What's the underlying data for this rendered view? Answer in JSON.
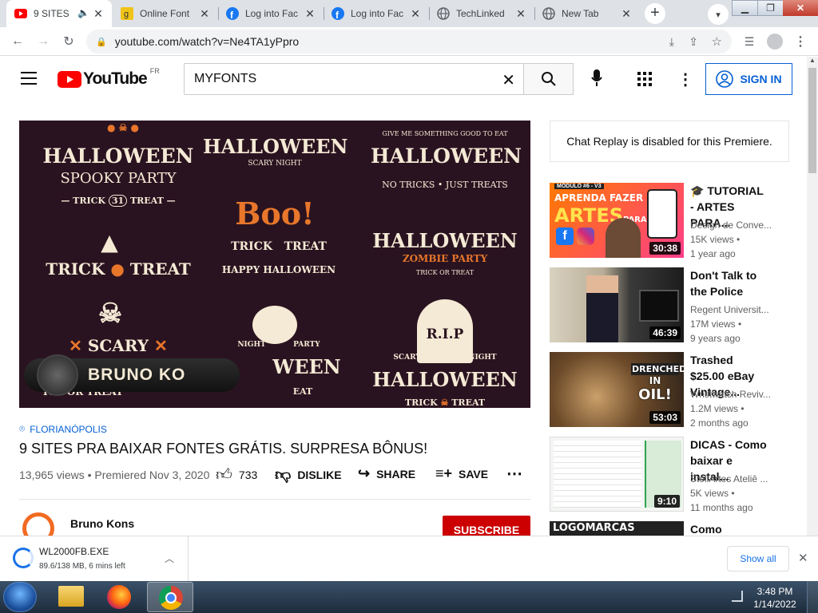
{
  "tabs": [
    {
      "title": "9 SITES",
      "icon": "youtube-icon",
      "audio": true
    },
    {
      "title": "Online Font",
      "icon": "font-site-icon"
    },
    {
      "title": "Log into Fac",
      "icon": "facebook-icon"
    },
    {
      "title": "Log into Fac",
      "icon": "facebook-icon"
    },
    {
      "title": "TechLinked",
      "icon": "globe-icon"
    },
    {
      "title": "New Tab",
      "icon": "chrome-icon"
    }
  ],
  "toolbar": {
    "url": "youtube.com/watch?v=Ne4TA1yPpro"
  },
  "yt": {
    "logo": "YouTube",
    "region": "FR",
    "search_value": "MYFONTS",
    "signin": "SIGN IN"
  },
  "video": {
    "overlay_name": "BRUNO KO",
    "art": {
      "c1_title": "HALLOWEEN",
      "c1_sub": "SPOOKY PARTY",
      "c1_trick": "TRICK",
      "c1_num": "31",
      "c1_treat": "TREAT",
      "c2_title": "HALLOWEEN",
      "c2_sub": "SCARY NIGHT",
      "c3_top": "GIVE ME SOMETHING GOOD TO EAT",
      "c3_title": "HALLOWEEN",
      "c3_sub": "NO TRICKS • JUST TREATS",
      "trick_treat": "TRICK",
      "trick_treat2": "TREAT",
      "boo": "Boo!",
      "mid_trick": "TRICK",
      "mid_treat": "TREAT",
      "happy": "HAPPY HALLOWEEN",
      "zombie_title": "HALLOWEEN",
      "zombie_sub": "ZOMBIE PARTY",
      "zombie_small": "TRICK OR TREAT",
      "scary": "SCARY",
      "night": "NIGHT",
      "party": "PARTY",
      "bottom_mid": "WEEN",
      "rip": "R.I.P",
      "scary2": "SCARY",
      "night2": "NIGHT",
      "bottom_right": "HALLOWEEN",
      "br_trick": "TRICK",
      "br_treat": "TREAT",
      "left_bottom": "ICK OR TREAT",
      "mid_bottom": "EAT"
    }
  },
  "meta": {
    "location": "FLORIANÓPOLIS",
    "title": "9 SITES PRA BAIXAR FONTES GRÁTIS. SURPRESA BÔNUS!",
    "views": "13,965 views",
    "premiered": "Premiered Nov 3, 2020",
    "likes": "733",
    "dislike": "DISLIKE",
    "share": "SHARE",
    "save": "SAVE",
    "channel": "Bruno Kons",
    "subscribe": "SUBSCRIBE"
  },
  "sidebar": {
    "chat_replay": "Chat Replay is disabled for this Premiere.",
    "recs": [
      {
        "title": "🎓 TUTORIAL - ARTES PARA...",
        "channel": "Design de Conve...",
        "views": "15K views •",
        "age": "1 year ago",
        "duration": "30:38",
        "thumb": {
          "tag": "MÓDULO #6 - V3",
          "l1": "APRENDA FAZER",
          "l2": "ARTES",
          "l3": "PARA"
        }
      },
      {
        "title": "Don't Talk to the Police",
        "channel": "Regent Universit...",
        "views": "17M views •",
        "age": "9 years ago",
        "duration": "46:39"
      },
      {
        "title": "Trashed $25.00 eBay Vintage...",
        "channel": "Wristwatch Reviv...",
        "views": "1.2M views •",
        "age": "2 months ago",
        "duration": "53:03",
        "thumb": {
          "l1": "DRENCHED",
          "l2": "IN",
          "l3": "OIL!"
        }
      },
      {
        "title": "DICAS - Como baixar e instal...",
        "channel": "StellArtes Ateliê ...",
        "views": "5K views •",
        "age": "11 months ago",
        "duration": "9:10"
      },
      {
        "title": "Como",
        "thumb": {
          "l1": "LOGOMARCAS"
        }
      }
    ]
  },
  "download": {
    "filename": "WL2000FB.EXE",
    "status": "89.6/138 MB, 6 mins left",
    "show_all": "Show all"
  },
  "taskbar": {
    "time": "3:48 PM",
    "date": "1/14/2022"
  }
}
